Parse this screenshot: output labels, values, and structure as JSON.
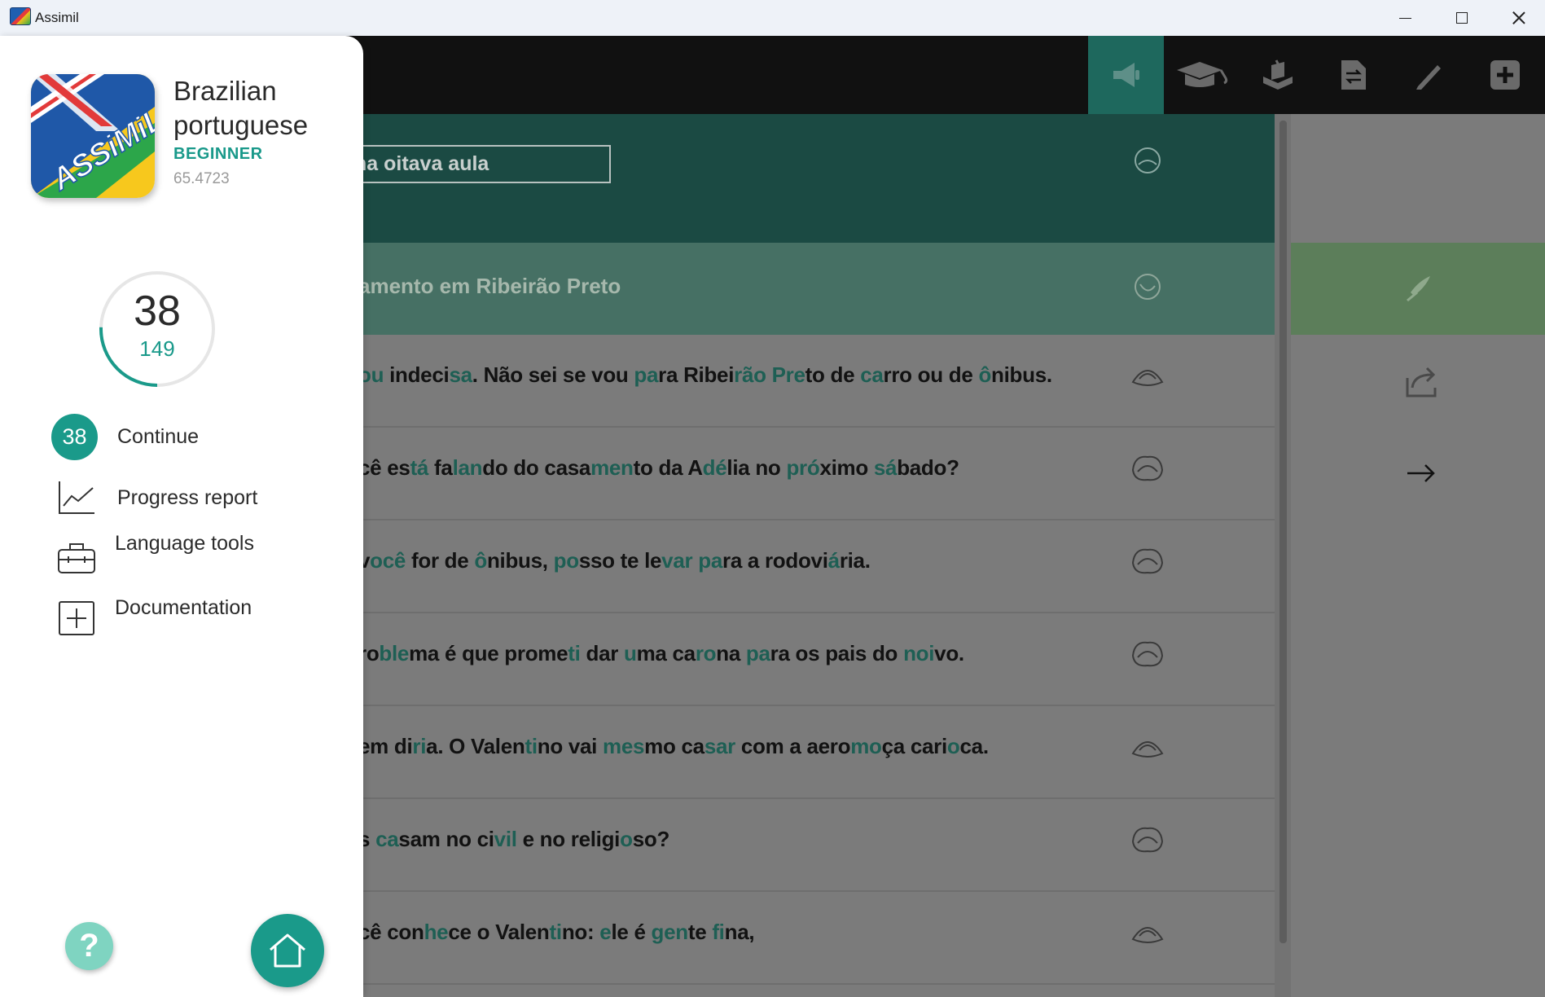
{
  "window": {
    "title": "Assimil"
  },
  "drawer": {
    "course": {
      "name": "Brazilian portuguese",
      "level": "BEGINNER",
      "version": "65.4723",
      "logo_text": "ASSiMiL"
    },
    "progress": {
      "current": "38",
      "total": "149",
      "fraction": 0.255
    },
    "menu": [
      {
        "label": "Continue",
        "badge": "38"
      },
      {
        "label": "Progress report"
      },
      {
        "label": "Language tools"
      },
      {
        "label": "Documentation"
      }
    ],
    "help_label": "?"
  },
  "lesson": {
    "title_visible": "gésima oitava aula",
    "subtitle_visible": "amento em Ribeirão Preto",
    "lines": [
      {
        "segments": [
          [
            "ou",
            true
          ],
          [
            " indeci",
            false
          ],
          [
            "sa",
            true
          ],
          [
            ". Não sei se vou ",
            false
          ],
          [
            "pa",
            true
          ],
          [
            "ra Ribei",
            false
          ],
          [
            "rão",
            true
          ],
          [
            " ",
            false
          ],
          [
            "Pre",
            true
          ],
          [
            "to de ",
            false
          ],
          [
            "ca",
            true
          ],
          [
            "rro ou de ",
            false
          ],
          [
            "ô",
            true
          ],
          [
            "nibus.",
            false
          ]
        ]
      },
      {
        "segments": [
          [
            "cê",
            false
          ],
          [
            " es",
            false
          ],
          [
            "tá",
            true
          ],
          [
            " fa",
            false
          ],
          [
            "lan",
            true
          ],
          [
            "do do casa",
            false
          ],
          [
            "men",
            true
          ],
          [
            "to da A",
            false
          ],
          [
            "dé",
            true
          ],
          [
            "lia no ",
            false
          ],
          [
            "pró",
            true
          ],
          [
            "ximo ",
            false
          ],
          [
            "sá",
            true
          ],
          [
            "bado?",
            false
          ]
        ]
      },
      {
        "segments": [
          [
            "v",
            false
          ],
          [
            "ocê",
            true
          ],
          [
            " for de ",
            false
          ],
          [
            "ô",
            true
          ],
          [
            "nibus, ",
            false
          ],
          [
            "po",
            true
          ],
          [
            "sso te le",
            false
          ],
          [
            "var",
            true
          ],
          [
            " ",
            false
          ],
          [
            "pa",
            true
          ],
          [
            "ra a rodovi",
            false
          ],
          [
            "á",
            true
          ],
          [
            "ria.",
            false
          ]
        ]
      },
      {
        "segments": [
          [
            "ro",
            false
          ],
          [
            "ble",
            true
          ],
          [
            "ma é que prome",
            false
          ],
          [
            "ti",
            true
          ],
          [
            " dar ",
            false
          ],
          [
            "u",
            true
          ],
          [
            "ma ca",
            false
          ],
          [
            "ro",
            true
          ],
          [
            "na ",
            false
          ],
          [
            "pa",
            true
          ],
          [
            "ra os pais do ",
            false
          ],
          [
            "noi",
            true
          ],
          [
            "vo.",
            false
          ]
        ]
      },
      {
        "segments": [
          [
            "em di",
            false
          ],
          [
            "ri",
            true
          ],
          [
            "a. O Valen",
            false
          ],
          [
            "ti",
            true
          ],
          [
            "no vai ",
            false
          ],
          [
            "mes",
            true
          ],
          [
            "mo ca",
            false
          ],
          [
            "sar",
            true
          ],
          [
            " com a aero",
            false
          ],
          [
            "mo",
            true
          ],
          [
            "ça cari",
            false
          ],
          [
            "o",
            true
          ],
          [
            "ca.",
            false
          ]
        ]
      },
      {
        "segments": [
          [
            "s ",
            false
          ],
          [
            "ca",
            true
          ],
          [
            "sam no ci",
            false
          ],
          [
            "vil",
            true
          ],
          [
            " e no religi",
            false
          ],
          [
            "o",
            true
          ],
          [
            "so?",
            false
          ]
        ]
      },
      {
        "segments": [
          [
            "cê",
            false
          ],
          [
            " con",
            false
          ],
          [
            "he",
            true
          ],
          [
            "ce o Valen",
            false
          ],
          [
            "ti",
            true
          ],
          [
            "no: ",
            false
          ],
          [
            "e",
            true
          ],
          [
            "le é ",
            false
          ],
          [
            "gen",
            true
          ],
          [
            "te ",
            false
          ],
          [
            "fi",
            true
          ],
          [
            "na,",
            false
          ]
        ]
      }
    ]
  },
  "toolbar": {
    "buttons": [
      {
        "icon": "megaphone-icon",
        "active": true
      },
      {
        "icon": "graduation-cap-icon",
        "active": false
      },
      {
        "icon": "book-stand-icon",
        "active": false
      },
      {
        "icon": "document-swap-icon",
        "active": false
      },
      {
        "icon": "pen-icon",
        "active": false
      },
      {
        "icon": "plus-box-icon",
        "active": false
      }
    ]
  },
  "colors": {
    "accent": "#1a9a8a",
    "header": "#1b4a43",
    "toolbar": "#111111",
    "help": "#7fd4c1"
  }
}
